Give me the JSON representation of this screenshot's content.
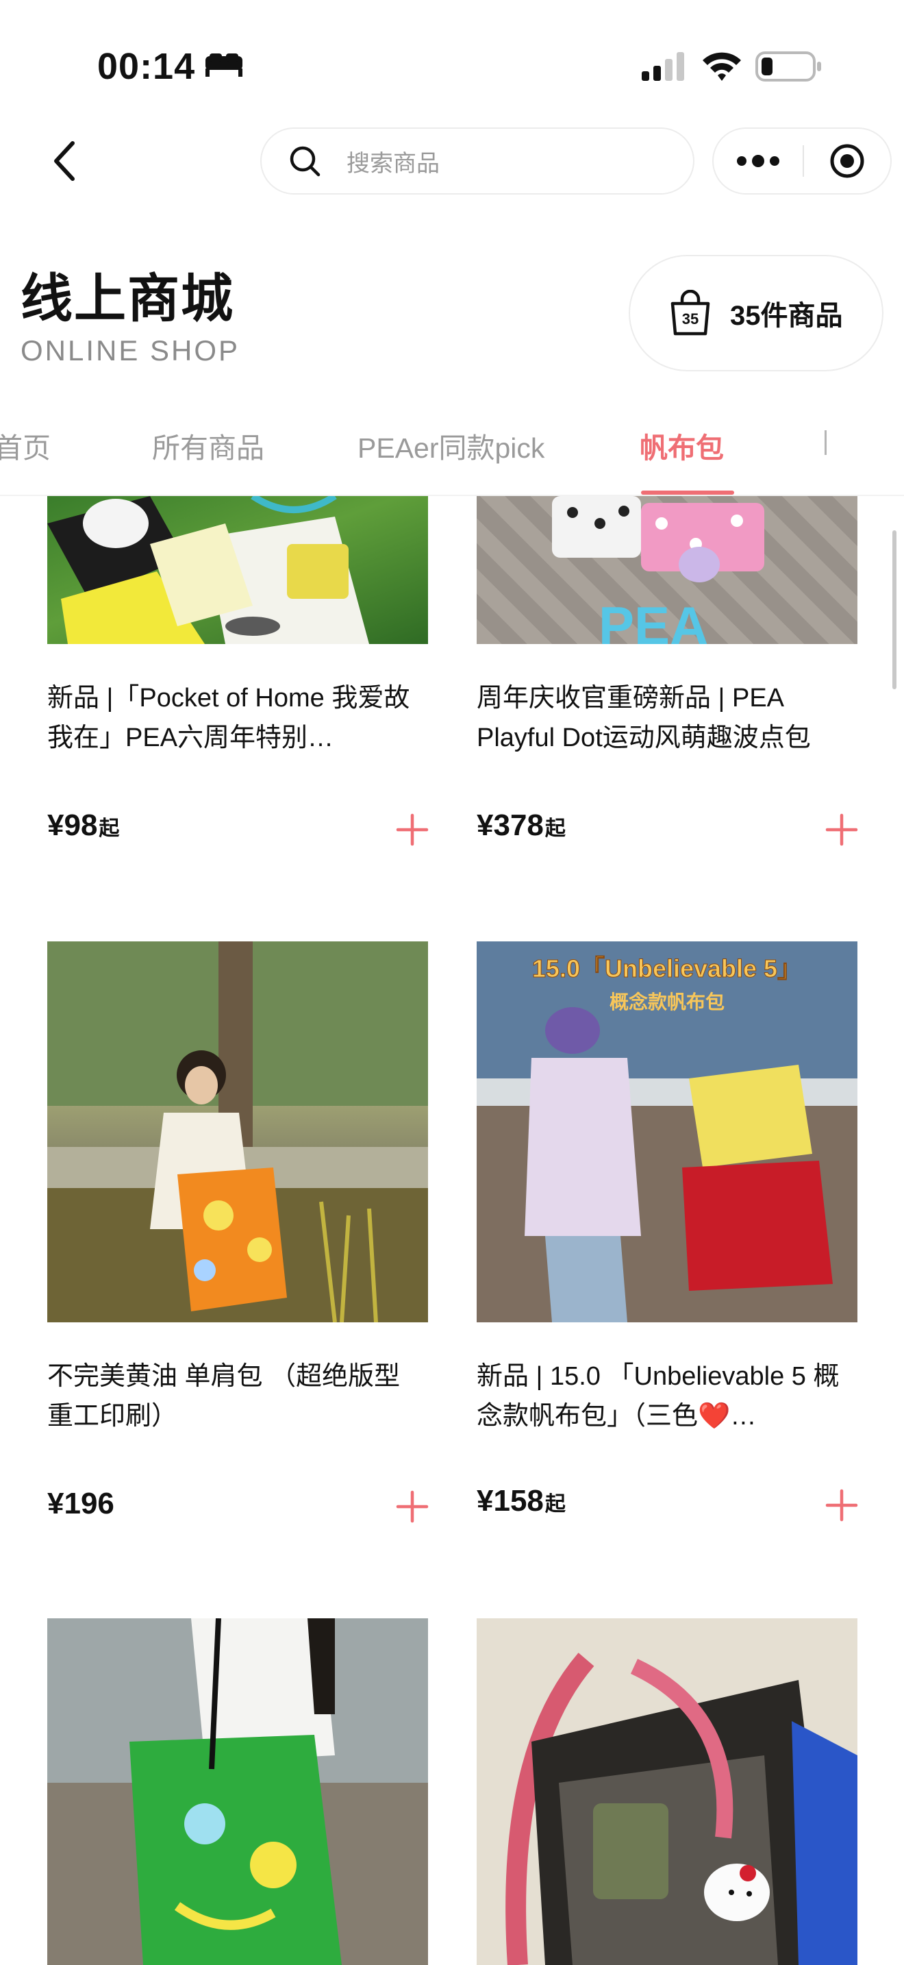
{
  "status_bar": {
    "time": "00:14"
  },
  "nav": {
    "search_placeholder": "搜索商品"
  },
  "header": {
    "title": "线上商城",
    "subtitle": "ONLINE SHOP",
    "cart_count": "35",
    "cart_label": "35件商品"
  },
  "tabs": [
    {
      "label": "首页",
      "active": false
    },
    {
      "label": "所有商品",
      "active": false
    },
    {
      "label": "PEAer同款pick",
      "active": false
    },
    {
      "label": "帆布包",
      "active": true
    }
  ],
  "products": [
    {
      "title": "新品 |「Pocket of Home 我爱故我在」PEA六周年特别…",
      "price": "¥98",
      "price_suffix": "起",
      "image_text": ""
    },
    {
      "title": "周年庆收官重磅新品 | PEA Playful Dot运动风萌趣波点包",
      "price": "¥378",
      "price_suffix": "起",
      "image_text": "PEA"
    },
    {
      "title": "不完美黄油 单肩包 （超绝版型 重工印刷）",
      "price": "¥196",
      "price_suffix": "",
      "image_text": ""
    },
    {
      "title": "新品 | 15.0 「Unbelievable 5 概念款帆布包」（三色❤️…",
      "price": "¥158",
      "price_suffix": "起",
      "image_text": "15.0「Unbelievable 5」",
      "image_subtext": "概念款帆布包"
    },
    {
      "title": "",
      "price": "",
      "price_suffix": "",
      "image_text": ""
    },
    {
      "title": "",
      "price": "",
      "price_suffix": "",
      "image_text": ""
    }
  ],
  "colors": {
    "accent": "#ef6e74",
    "text": "#111111",
    "muted": "#9a9a9a"
  }
}
